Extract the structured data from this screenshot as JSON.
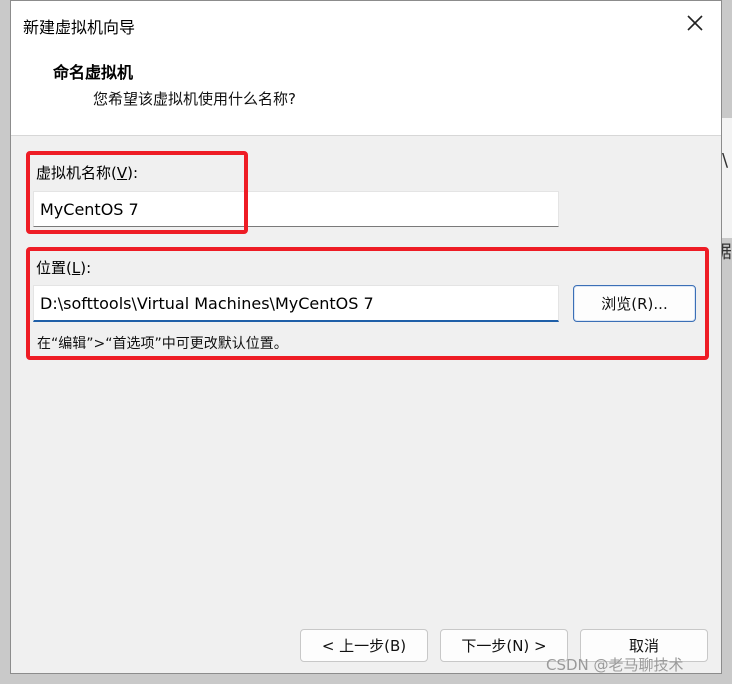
{
  "dialog": {
    "title": "新建虚拟机向导",
    "close_icon": "close-icon"
  },
  "header": {
    "title": "命名虚拟机",
    "subtitle": "您希望该虚拟机使用什么名称?"
  },
  "name_field": {
    "label_prefix": "虚拟机名称(",
    "label_mnemonic": "V",
    "label_suffix": "):",
    "value": "MyCentOS 7"
  },
  "location_field": {
    "label_prefix": "位置(",
    "label_mnemonic": "L",
    "label_suffix": "):",
    "value": "D:\\softtools\\Virtual Machines\\MyCentOS 7",
    "browse_label": "浏览(R)...",
    "hint": "在“编辑”>“首选项”中可更改默认位置。"
  },
  "footer": {
    "back_label": "< 上一步(B)",
    "next_label": "下一步(N) >",
    "cancel_label": "取消"
  },
  "background": {
    "glyph_top": "\\",
    "glyph_bottom": "剧"
  },
  "watermark": "CSDN @老马聊技术",
  "colors": {
    "highlight": "#ee1c25",
    "accent": "#1f5fa8"
  }
}
